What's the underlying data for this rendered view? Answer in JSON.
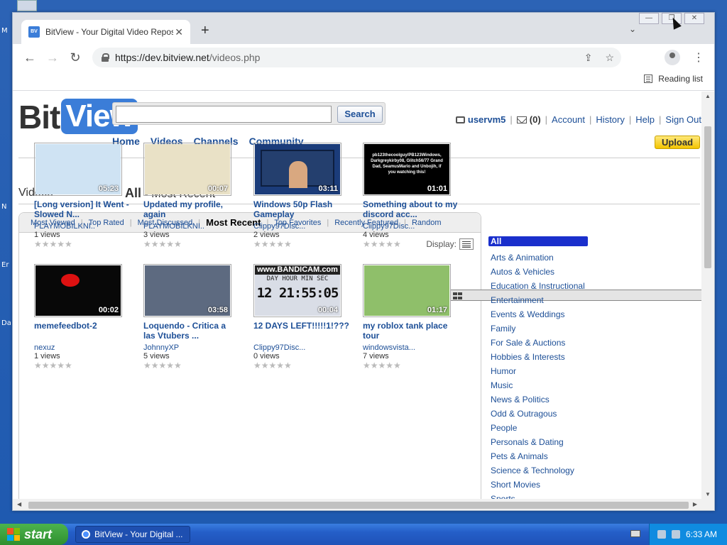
{
  "desktop": {
    "labels": [
      "M",
      "N",
      "Er",
      "Da"
    ]
  },
  "browser": {
    "tab_title": "BitView - Your Digital Video Reposit",
    "favicon_text": "Bit View",
    "new_tab": "+",
    "url_host": "https://dev.bitview.net",
    "url_path": "/videos.php",
    "reading_list": "Reading list"
  },
  "site": {
    "logo_bit": "Bit",
    "logo_view": "View",
    "search_button": "Search",
    "search_value": "",
    "nav": [
      "Home",
      "Videos",
      "Channels",
      "Community"
    ],
    "username": "uservm5",
    "inbox_count": "(0)",
    "account": "Account",
    "history": "History",
    "help": "Help",
    "sign_out": "Sign Out",
    "upload": "Upload"
  },
  "page": {
    "section_title": "Videos",
    "heading_bold": "All",
    "heading_rest": " - Most Recent",
    "display_label": "Display:",
    "tabs": [
      "Most Viewed",
      "Top Rated",
      "Most Discussed",
      "Most Recent",
      "Top Favorites",
      "Recently Featured",
      "Random"
    ],
    "active_tab": "Most Recent"
  },
  "videos": [
    {
      "title": "[Long version] It Went - Slowed N...",
      "user": "PLAYMOBILKNI..",
      "views": "1 views",
      "duration": "05:23",
      "thumb": "#cfe3f3"
    },
    {
      "title": "Updated my profile, again",
      "user": "PLAYMOBILKNI..",
      "views": "3 views",
      "duration": "00:07",
      "thumb": "#e9e1c6"
    },
    {
      "title": "Windows 50p Flash Gameplay",
      "user": "Clippy97Disc...",
      "views": "2 views",
      "duration": "03:11",
      "thumb": "#1b3c7a"
    },
    {
      "title": "Something about to my discord acc...",
      "user": "Clippy97Disc...",
      "views": "4 views",
      "duration": "01:01",
      "thumb": "#000000"
    },
    {
      "title": "memefeedbot-2",
      "user": "nexuz",
      "views": "1 views",
      "duration": "00:02",
      "thumb": "#080808"
    },
    {
      "title": "Loquendo - Critica a las Vtubers ...",
      "user": "JohnnyXP",
      "views": "5 views",
      "duration": "03:58",
      "thumb": "#5d6a80"
    },
    {
      "title": "12 DAYS LEFT!!!!!1!???",
      "user": "Clippy97Disc...",
      "views": "0 views",
      "duration": "00:04",
      "thumb": "#d9dde6"
    },
    {
      "title": "my roblox tank place tour",
      "user": "windowsvista...",
      "views": "7 views",
      "duration": "01:17",
      "thumb": "#8fbf6a"
    }
  ],
  "thumb_text": {
    "something": "pb123thecoolguy/PB123Windows, Darkgreykirby08, Glitch56/77 Grand Dad, SeamusMario and Unbojih, if you watching this!",
    "bandicam": "www.BANDICAM.com",
    "countdown_labels": "DAY HOUR MIN SEC",
    "countdown": "12 21:55:05"
  },
  "categories": [
    "All",
    "Arts & Animation",
    "Autos & Vehicles",
    "Education & Instructional",
    "Entertainment",
    "Events & Weddings",
    "Family",
    "For Sale & Auctions",
    "Hobbies & Interests",
    "Humor",
    "Music",
    "News & Politics",
    "Odd & Outragous",
    "People",
    "Personals & Dating",
    "Pets & Animals",
    "Science & Technology",
    "Short Movies",
    "Sports"
  ],
  "taskbar": {
    "start": "start",
    "task_title": "BitView - Your Digital ...",
    "clock": "6:33 AM"
  },
  "stars": "★★★★★"
}
